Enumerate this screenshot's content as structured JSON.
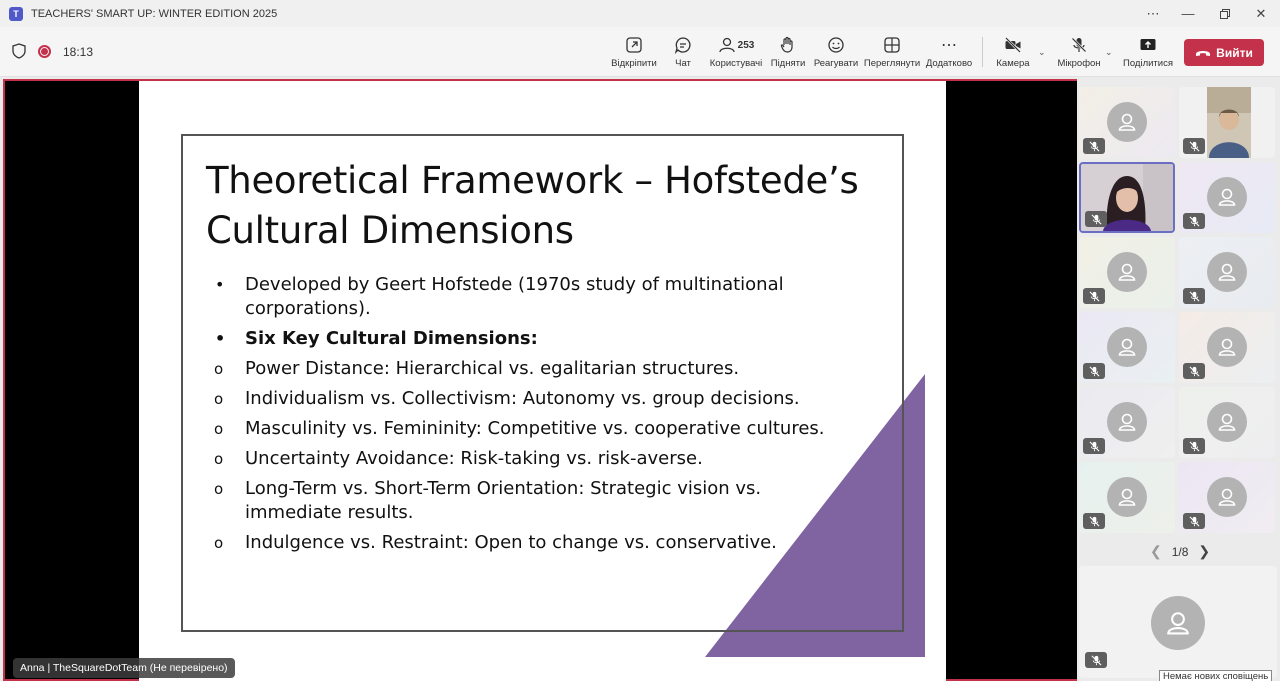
{
  "window": {
    "title": "TEACHERS' SMART UP: WINTER EDITION 2025",
    "more_icon": "ellipsis-icon",
    "controls": [
      "minimize",
      "restore",
      "close"
    ]
  },
  "toolbar": {
    "timer": "18:13",
    "buttons": {
      "open": "Відкріпити",
      "chat": "Чат",
      "participants_count": "253",
      "participants": "Користувачі",
      "raise": "Підняти",
      "react": "Реагувати",
      "view": "Переглянути",
      "apps": "Додатково",
      "camera": "Камера",
      "mic": "Мікрофон",
      "share": "Поділитися"
    },
    "leave": "Вийти",
    "leave_color": "#c4314b"
  },
  "slide": {
    "title": "Theoretical Framework – Hofstede’s Cultural Dimensions",
    "accent_color": "#8064a2",
    "bullets": [
      {
        "marker": "•",
        "text": "Developed by Geert Hofstede (1970s study of multinational corporations).",
        "bold": false
      },
      {
        "marker": "•",
        "text": "Six Key Cultural Dimensions:",
        "bold": true
      },
      {
        "marker": "o",
        "text": "Power Distance: Hierarchical vs. egalitarian structures.",
        "bold": false
      },
      {
        "marker": "o",
        "text": "Individualism vs. Collectivism: Autonomy vs. group decisions.",
        "bold": false
      },
      {
        "marker": "o",
        "text": "Masculinity vs. Femininity: Competitive vs. cooperative cultures.",
        "bold": false
      },
      {
        "marker": "o",
        "text": "Uncertainty Avoidance: Risk-taking vs. risk-averse.",
        "bold": false
      },
      {
        "marker": "o",
        "text": "Long-Term vs. Short-Term Orientation: Strategic vision vs. immediate results.",
        "bold": false
      },
      {
        "marker": "o",
        "text": "Indulgence vs. Restraint: Open to change vs. conservative.",
        "bold": false
      }
    ],
    "presenter_caption": "Anna | TheSquareDotTeam (Не перевірено)"
  },
  "gallery": {
    "page": "1/8",
    "no_notifications": "Немає нових сповіщень"
  }
}
